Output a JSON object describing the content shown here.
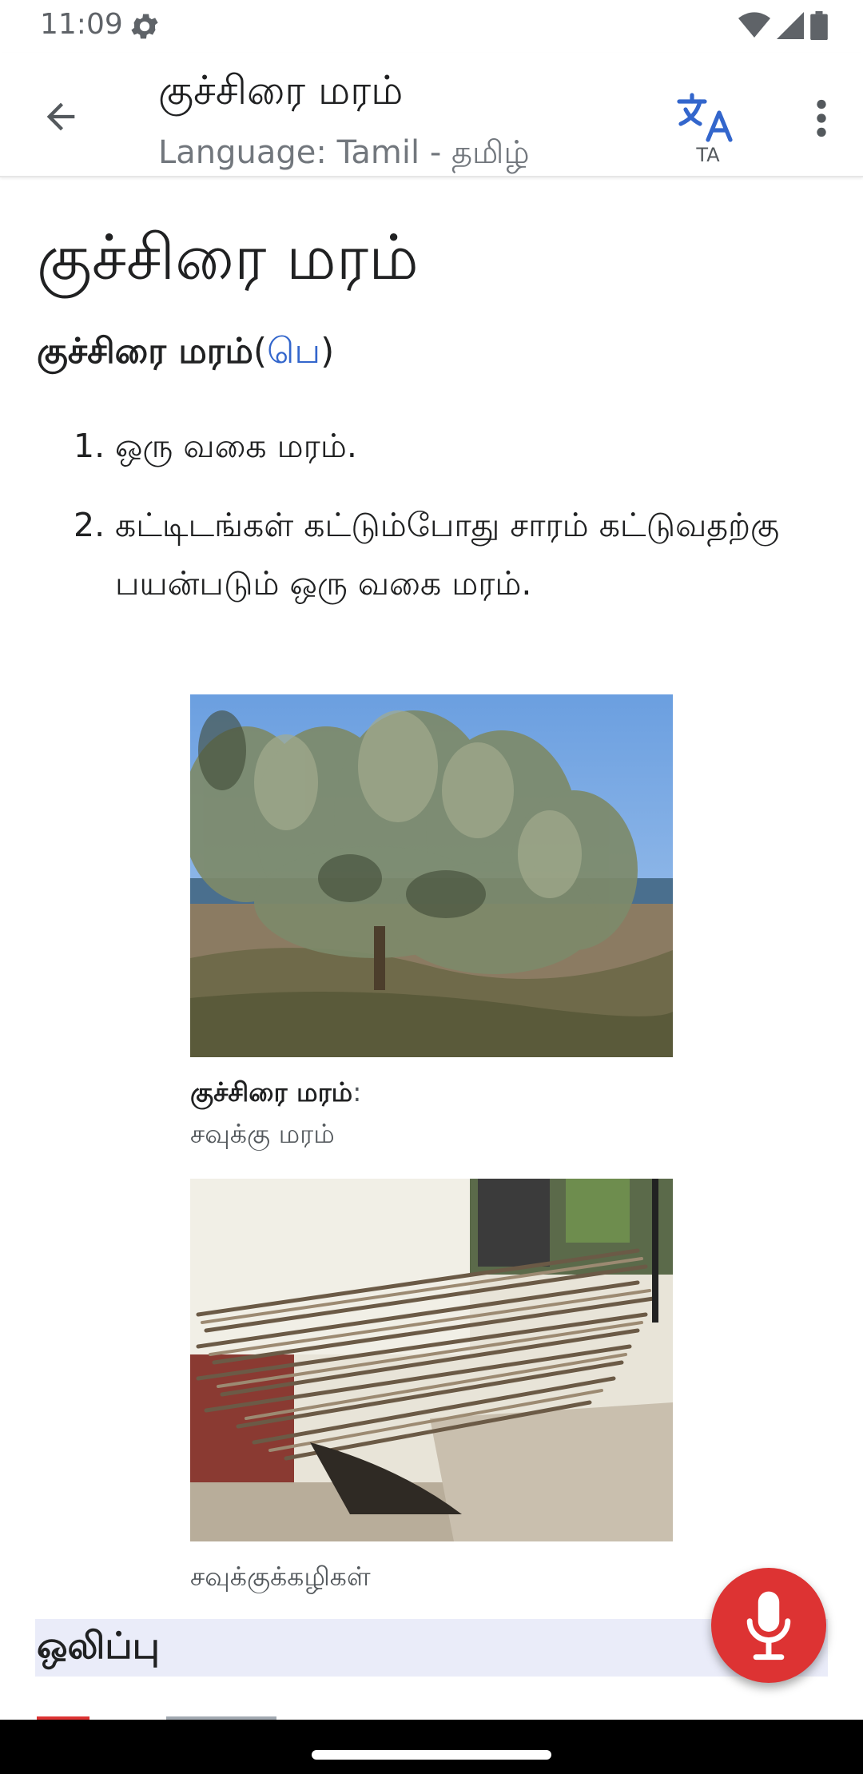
{
  "status_bar": {
    "time": "11:09",
    "icons": [
      "settings-icon",
      "wifi-icon",
      "signal-icon",
      "battery-icon"
    ]
  },
  "app_bar": {
    "title": "குச்சிரை மரம்",
    "subtitle": "Language: Tamil - தமிழ்",
    "language_code": "TA",
    "icons": [
      "back-arrow-icon",
      "translate-icon",
      "more-vert-icon"
    ]
  },
  "article": {
    "heading": "குச்சிரை மரம்",
    "headword": "குச்சிரை மரம்",
    "paren_open": "(",
    "pos_link": "பெ",
    "paren_close": ")",
    "definitions": [
      {
        "number": "1.",
        "text": "ஒரு வகை மரம்."
      },
      {
        "number": "2.",
        "text": "கட்டிடங்கள் கட்டும்போது சாரம் கட்டுவதற்கு பயன்படும் ஒரு வகை மரம்."
      }
    ],
    "figures": [
      {
        "caption_bold": "குச்சிரை மரம்",
        "caption_sep": ":",
        "caption_text": "சவுக்கு மரம்"
      },
      {
        "caption_text": "சவுக்குக்கழிகள்"
      }
    ],
    "section_title": "ஒலிப்பு"
  },
  "colors": {
    "link": "#3366cc",
    "accent": "#dd3333",
    "section_bg": "#eaecf9"
  },
  "fab": {
    "icon": "microphone-icon"
  }
}
